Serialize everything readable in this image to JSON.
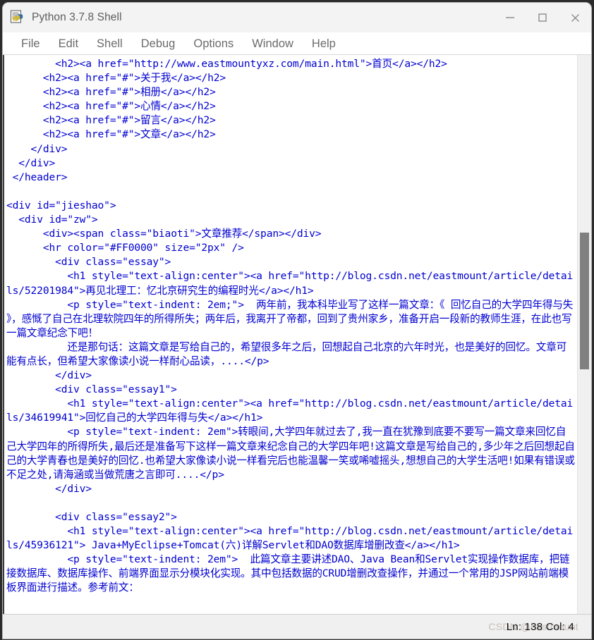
{
  "window": {
    "title": "Python 3.7.8 Shell",
    "icon": "python-idle-icon",
    "controls": {
      "minimize": "minimize-button",
      "maximize": "maximize-button",
      "close": "close-button"
    }
  },
  "menubar": {
    "items": [
      {
        "label": "File"
      },
      {
        "label": "Edit"
      },
      {
        "label": "Shell"
      },
      {
        "label": "Debug"
      },
      {
        "label": "Options"
      },
      {
        "label": "Window"
      },
      {
        "label": "Help"
      }
    ]
  },
  "editor": {
    "text_color": "#0000d0",
    "background": "#ffffff",
    "content": "        <h2><a href=\"http://www.eastmountyxz.com/main.html\">首页</a></h2>\n      <h2><a href=\"#\">关于我</a></h2>\n      <h2><a href=\"#\">相册</a></h2>\n      <h2><a href=\"#\">心情</a></h2>\n      <h2><a href=\"#\">留言</a></h2>\n      <h2><a href=\"#\">文章</a></h2>\n    </div>\n  </div>\n </header>\n\n<div id=\"jieshao\">\n  <div id=\"zw\">\n      <div><span class=\"biaoti\">文章推荐</span></div>\n      <hr color=\"#FF0000\" size=\"2px\" />\n        <div class=\"essay\">\n          <h1 style=\"text-align:center\"><a href=\"http://blog.csdn.net/eastmount/article/details/52201984\">再见北理工：忆北京研究生的编程时光</a></h1>\n          <p style=\"text-indent: 2em;\">  两年前，我本科毕业写了这样一篇文章：《 回忆自己的大学四年得与失 》，感慨了自己在北理软院四年的所得所失；两年后，我离开了帝都，回到了贵州家乡，准备开启一段新的教师生涯，在此也写一篇文章纪念下吧！\n          还是那句话：这篇文章是写给自己的，希望很多年之后，回想起自己北京的六年时光，也是美好的回忆。文章可能有点长，但希望大家像读小说一样耐心品读，....</p>\n        </div>\n        <div class=\"essay1\">\n          <h1 style=\"text-align:center\"><a href=\"http://blog.csdn.net/eastmount/article/details/34619941\">回忆自己的大学四年得与失</a></h1>\n          <p style=\"text-indent: 2em\">转眼间,大学四年就过去了,我一直在犹豫到底要不要写一篇文章来回忆自己大学四年的所得所失,最后还是准备写下这样一篇文章来纪念自己的大学四年吧!这篇文章是写给自己的,多少年之后回想起自己的大学青春也是美好的回忆.也希望大家像读小说一样看完后也能温馨一笑或唏嘘摇头,想想自己的大学生活吧!如果有错误或不足之处,请海涵或当做荒唐之言即可....</p>\n        </div>\n\n        <div class=\"essay2\">\n          <h1 style=\"text-align:center\"><a href=\"http://blog.csdn.net/eastmount/article/details/45936121\"> Java+MyEclipse+Tomcat(六)详解Servlet和DAO数据库增删改查</a></h1>\n          <p style=\"text-indent: 2em\">  此篇文章主要讲述DAO、Java Bean和Servlet实现操作数据库，把链接数据库、数据库操作、前端界面显示分模块化实现。其中包括数据的CRUD增删改查操作，并通过一个常用的JSP网站前端模板界面进行描述。参考前文："
  },
  "scrollbar": {
    "orientation": "vertical",
    "thumb_color": "#808080"
  },
  "statusbar": {
    "position": "Ln: 138  Col: 4",
    "watermark": "CSDN @eastmount"
  }
}
